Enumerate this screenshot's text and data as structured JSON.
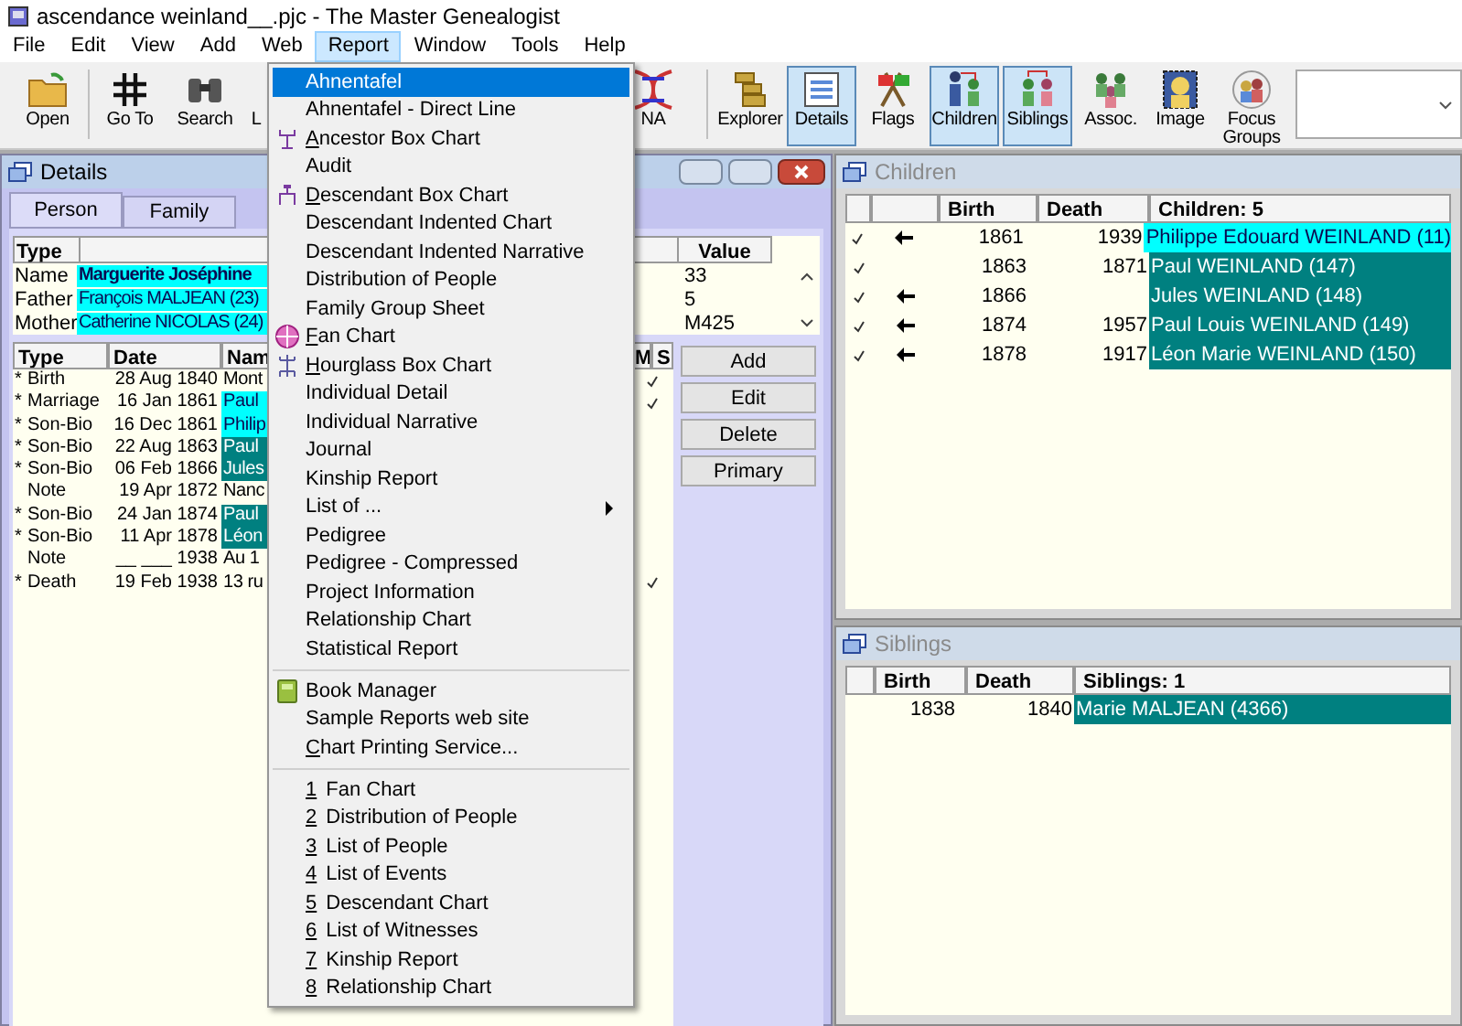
{
  "window": {
    "title": "ascendance weinland__.pjc - The Master Genealogist"
  },
  "menu_bar": [
    {
      "label": "File",
      "selected": false
    },
    {
      "label": "Edit",
      "selected": false
    },
    {
      "label": "View",
      "selected": false
    },
    {
      "label": "Add",
      "selected": false
    },
    {
      "label": "Web",
      "selected": false
    },
    {
      "label": "Report",
      "selected": true
    },
    {
      "label": "Window",
      "selected": false
    },
    {
      "label": "Tools",
      "selected": false
    },
    {
      "label": "Help",
      "selected": false
    }
  ],
  "toolbar": [
    {
      "label": "Open",
      "selected": false
    },
    {
      "label": "Go To",
      "selected": false
    },
    {
      "label": "Search",
      "selected": false
    },
    {
      "label": "L",
      "selected": false
    },
    {
      "label": "NA",
      "selected": false
    },
    {
      "label": "Explorer",
      "selected": false
    },
    {
      "label": "Details",
      "selected": true
    },
    {
      "label": "Flags",
      "selected": false
    },
    {
      "label": "Children",
      "selected": true
    },
    {
      "label": "Siblings",
      "selected": true
    },
    {
      "label": "Assoc.",
      "selected": false
    },
    {
      "label": "Image",
      "selected": false
    },
    {
      "label": "Focus Groups",
      "selected": false
    }
  ],
  "details": {
    "title": "Details",
    "tabs": [
      {
        "label": "Person",
        "selected": true
      },
      {
        "label": "Family",
        "selected": false
      }
    ],
    "header_columns": [
      "Type",
      "Value"
    ],
    "header_rows": [
      {
        "type": "Name",
        "name": "Marguerite Joséphine",
        "value": "33"
      },
      {
        "type": "Father",
        "name": "François MALJEAN (23)",
        "value": "5"
      },
      {
        "type": "Mother",
        "name": "Catherine NICOLAS (24)",
        "value": "M425"
      }
    ],
    "event_columns": [
      "Type",
      "Date",
      "Nam",
      "M",
      "S"
    ],
    "events": [
      {
        "marker": "*",
        "type": "Birth",
        "date": "28 Aug 1840",
        "name": "Mont",
        "s": true
      },
      {
        "marker": "*",
        "type": "Marriage",
        "date": "16 Jan 1861",
        "name": "Paul",
        "color": "#00ffff",
        "s": true
      },
      {
        "marker": "*",
        "type": "Son-Bio",
        "date": "16 Dec 1861",
        "name": "Philip",
        "color": "#00ffff",
        "s": false
      },
      {
        "marker": "*",
        "type": "Son-Bio",
        "date": "22 Aug 1863",
        "name": "Paul",
        "color": "#008080",
        "s": false
      },
      {
        "marker": "*",
        "type": "Son-Bio",
        "date": "06 Feb 1866",
        "name": "Jules",
        "color": "#008080",
        "s": false
      },
      {
        "type": "Note",
        "date": "19 Apr 1872",
        "name": "Nanc",
        "s": false
      },
      {
        "marker": "*",
        "type": "Son-Bio",
        "date": "24 Jan 1874",
        "name": "Paul",
        "color": "#008080",
        "s": false
      },
      {
        "marker": "*",
        "type": "Son-Bio",
        "date": "11 Apr 1878",
        "name": "Léon",
        "color": "#008080",
        "s": false
      },
      {
        "type": "Note",
        "date": "__ ___ 1938",
        "name": "Au 1",
        "s": false
      },
      {
        "marker": "*",
        "type": "Death",
        "date": "19 Feb 1938",
        "name": "13 ru",
        "s": true
      }
    ],
    "buttons": [
      "Add",
      "Edit",
      "Delete",
      "Primary"
    ]
  },
  "children": {
    "title": "Children",
    "columns": [
      "Birth",
      "Death",
      "Children: 5"
    ],
    "rows": [
      {
        "checked": true,
        "arrow": true,
        "birth": "1861",
        "death": "1939",
        "name": "Philippe Edouard WEINLAND (11)",
        "color": "#00ffff"
      },
      {
        "checked": true,
        "arrow": false,
        "birth": "1863",
        "death": "1871",
        "name": "Paul WEINLAND (147)",
        "color": "#008080"
      },
      {
        "checked": true,
        "arrow": true,
        "birth": "1866",
        "name": "Jules WEINLAND (148)",
        "color": "#008080"
      },
      {
        "checked": true,
        "arrow": true,
        "birth": "1874",
        "death": "1957",
        "name": "Paul Louis WEINLAND (149)",
        "color": "#008080"
      },
      {
        "checked": true,
        "arrow": true,
        "birth": "1878",
        "death": "1917",
        "name": "Léon Marie WEINLAND (150)",
        "color": "#008080"
      }
    ]
  },
  "siblings": {
    "title": "Siblings",
    "columns": [
      "Birth",
      "Death",
      "Siblings: 1"
    ],
    "rows": [
      {
        "birth": "1838",
        "death": "1840",
        "name": "Marie MALJEAN (4366)",
        "color": "#008080"
      }
    ]
  },
  "report_menu": [
    {
      "kind": "item",
      "text": "Ahnentafel",
      "selected": true
    },
    {
      "kind": "item",
      "text": "Ahnentafel - Direct Line",
      "selected": false
    },
    {
      "kind": "item",
      "mnemonic": "A",
      "text": "ncestor Box Chart",
      "selected": false
    },
    {
      "kind": "item",
      "text": "Audit",
      "selected": false
    },
    {
      "kind": "item",
      "mnemonic": "D",
      "text": "escendant Box Chart",
      "selected": false
    },
    {
      "kind": "item",
      "text": "Descendant Indented Chart",
      "selected": false
    },
    {
      "kind": "item",
      "text": "Descendant Indented Narrative",
      "selected": false
    },
    {
      "kind": "item",
      "text": "Distribution of People",
      "selected": false
    },
    {
      "kind": "item",
      "text": "Family Group Sheet",
      "selected": false
    },
    {
      "kind": "item",
      "mnemonic": "F",
      "text": "an Chart",
      "selected": false
    },
    {
      "kind": "item",
      "mnemonic": "H",
      "text": "ourglass Box Chart",
      "selected": false
    },
    {
      "kind": "item",
      "text": "Individual Detail",
      "selected": false
    },
    {
      "kind": "item",
      "text": "Individual Narrative",
      "selected": false
    },
    {
      "kind": "item",
      "text": "Journal",
      "selected": false
    },
    {
      "kind": "item",
      "text": "Kinship Report",
      "selected": false
    },
    {
      "kind": "submenu",
      "text": "List of ...",
      "selected": false
    },
    {
      "kind": "item",
      "text": "Pedigree",
      "selected": false
    },
    {
      "kind": "item",
      "text": "Pedigree - Compressed",
      "selected": false
    },
    {
      "kind": "item",
      "text": "Project Information",
      "selected": false
    },
    {
      "kind": "item",
      "text": "Relationship Chart",
      "selected": false
    },
    {
      "kind": "item",
      "text": "Statistical Report",
      "selected": false
    },
    {
      "kind": "separator"
    },
    {
      "kind": "item",
      "text": "Book Manager",
      "selected": false
    },
    {
      "kind": "item",
      "text": "Sample Reports web site",
      "selected": false
    },
    {
      "kind": "item",
      "mnemonic": "C",
      "text": "hart Printing Service...",
      "selected": false
    },
    {
      "kind": "separator"
    },
    {
      "kind": "recent",
      "mnemonic": "1",
      "text": "Fan Chart",
      "selected": false
    },
    {
      "kind": "recent",
      "mnemonic": "2",
      "text": "Distribution of People",
      "selected": false
    },
    {
      "kind": "recent",
      "mnemonic": "3",
      "text": "List of People",
      "selected": false
    },
    {
      "kind": "recent",
      "mnemonic": "4",
      "text": "List of Events",
      "selected": false
    },
    {
      "kind": "recent",
      "mnemonic": "5",
      "text": "Descendant Chart",
      "selected": false
    },
    {
      "kind": "recent",
      "mnemonic": "6",
      "text": "List of Witnesses",
      "selected": false
    },
    {
      "kind": "recent",
      "mnemonic": "7",
      "text": "Kinship Report",
      "selected": false
    },
    {
      "kind": "recent",
      "mnemonic": "8",
      "text": "Relationship Chart",
      "selected": false
    }
  ]
}
